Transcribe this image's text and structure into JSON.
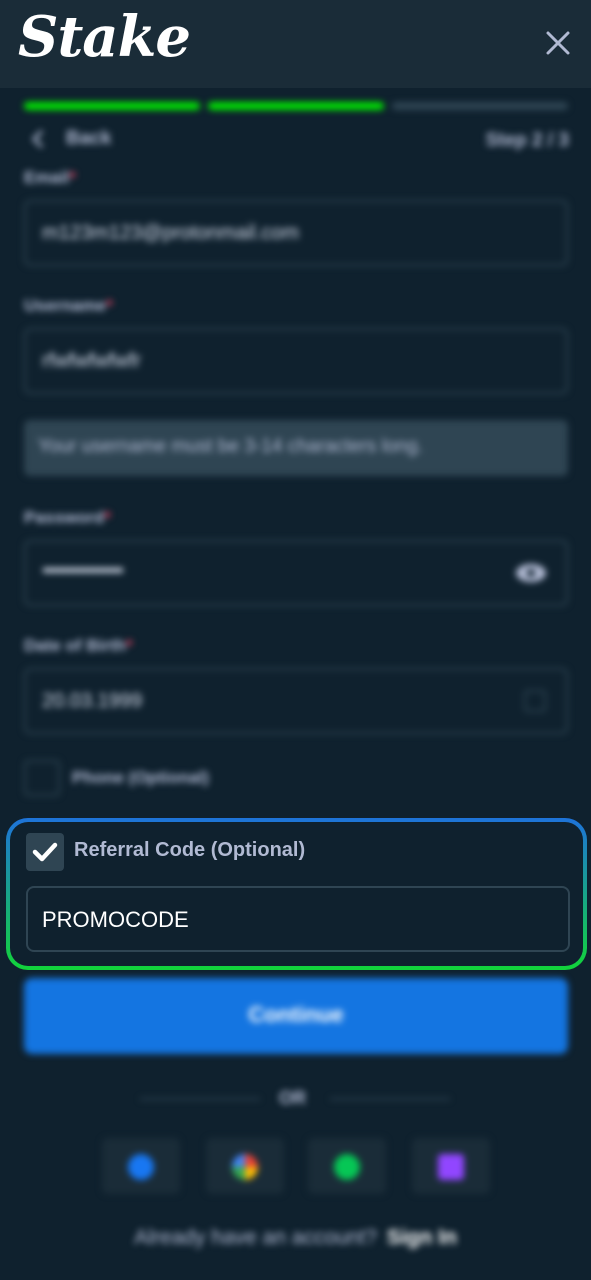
{
  "app": {
    "logo_text": "Stake"
  },
  "progress": {
    "step_label": "Step 2 / 3",
    "filled_segments": 2,
    "total_segments": 3
  },
  "nav": {
    "back_label": "Back"
  },
  "form": {
    "email": {
      "label": "Email",
      "value": "m123m123@protonmail.com"
    },
    "username": {
      "label": "Username",
      "value": "rfwfwfwfwfr",
      "hint": "Your username must be 3-14 characters long."
    },
    "password": {
      "label": "Password",
      "masked_value": "••••••••••••••••"
    },
    "dob": {
      "label": "Date of Birth",
      "value": "20.03.1999"
    },
    "phone": {
      "label": "Phone (Optional)",
      "checked": false
    },
    "referral": {
      "label": "Referral Code (Optional)",
      "checked": true,
      "value": "PROMOCODE"
    },
    "required_marker": "*"
  },
  "actions": {
    "continue_label": "Continue",
    "divider_text": "OR"
  },
  "social": [
    {
      "name": "facebook",
      "color": "#1877f2"
    },
    {
      "name": "google",
      "color": "#ea4335"
    },
    {
      "name": "line",
      "color": "#06c755"
    },
    {
      "name": "twitch",
      "color": "#9146ff"
    }
  ],
  "footer": {
    "prompt": "Already have an account?",
    "signin_label": "Sign In"
  },
  "colors": {
    "background": "#0f212e",
    "header": "#1a2c38",
    "accent_green": "#00e701",
    "primary_blue": "#1475e1"
  }
}
